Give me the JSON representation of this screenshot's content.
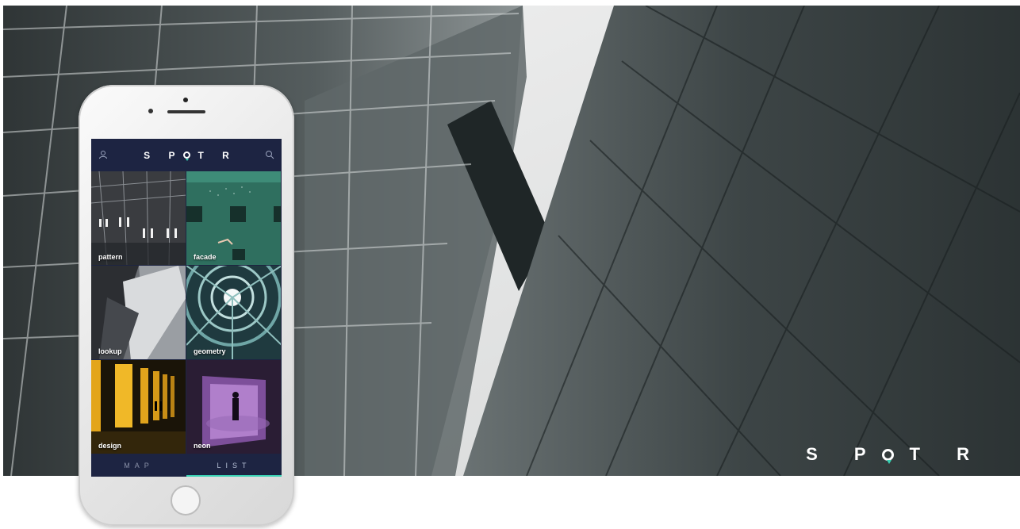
{
  "brand": {
    "letters_before": "S P",
    "letters_after": "T R",
    "accent_color": "#38d2b4"
  },
  "app": {
    "title_before": "S P",
    "title_after": "T R",
    "header_left_icon": "user-icon",
    "header_right_icon": "search-icon",
    "header_bg": "#1d2442",
    "tiles": [
      {
        "label": "pattern"
      },
      {
        "label": "facade"
      },
      {
        "label": "lookup"
      },
      {
        "label": "geometry"
      },
      {
        "label": "design"
      },
      {
        "label": "neon"
      }
    ],
    "tabs": [
      {
        "label": "MAP",
        "active": false
      },
      {
        "label": "LIST",
        "active": true
      }
    ]
  }
}
